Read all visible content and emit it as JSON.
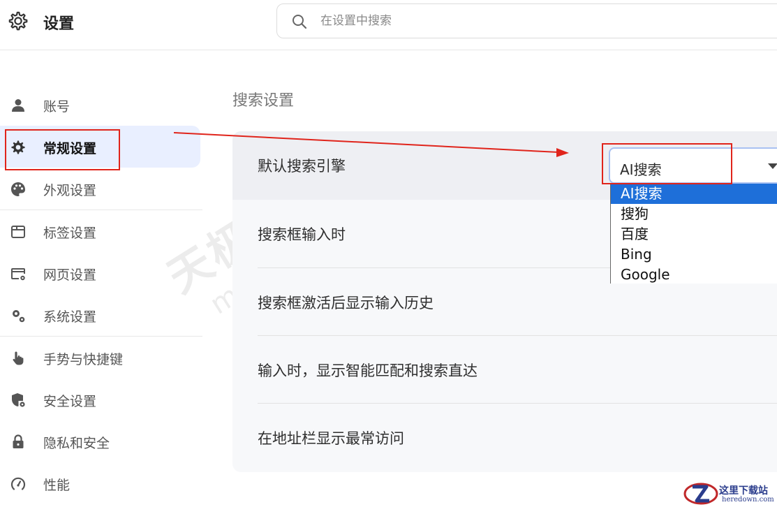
{
  "header": {
    "title": "设置",
    "search_placeholder": "在设置中搜索"
  },
  "sidebar": {
    "items": [
      {
        "label": "账号",
        "icon": "person-icon"
      },
      {
        "label": "常规设置",
        "icon": "gear-icon",
        "active": true
      },
      {
        "label": "外观设置",
        "icon": "palette-icon"
      },
      {
        "label": "标签设置",
        "icon": "tab-window-icon"
      },
      {
        "label": "网页设置",
        "icon": "webpage-settings-icon"
      },
      {
        "label": "系统设置",
        "icon": "system-gears-icon"
      },
      {
        "label": "手势与快捷键",
        "icon": "hand-pointer-icon"
      },
      {
        "label": "安全设置",
        "icon": "shield-settings-icon"
      },
      {
        "label": "隐私和安全",
        "icon": "lock-icon"
      },
      {
        "label": "性能",
        "icon": "speedometer-icon"
      }
    ]
  },
  "main": {
    "section_title": "搜索设置",
    "rows": [
      {
        "label": "默认搜索引擎"
      },
      {
        "label": "搜索框输入时"
      },
      {
        "label": "搜索框激活后显示输入历史"
      },
      {
        "label": "输入时，显示智能匹配和搜索直达"
      },
      {
        "label": "在地址栏显示最常访问"
      }
    ],
    "engine_select": {
      "value": "AI搜索",
      "options": [
        "AI搜索",
        "搜狗",
        "百度",
        "Bing",
        "Google"
      ]
    }
  },
  "watermark": {
    "main": "天极下载站",
    "sub": "mydown.yesky.com"
  },
  "logo": {
    "name": "这里下载站",
    "url": "heredown.com"
  },
  "colors": {
    "accent_selected": "#1e6fd9",
    "annotation_red": "#e0241b",
    "active_nav_bg": "#e9efff"
  }
}
